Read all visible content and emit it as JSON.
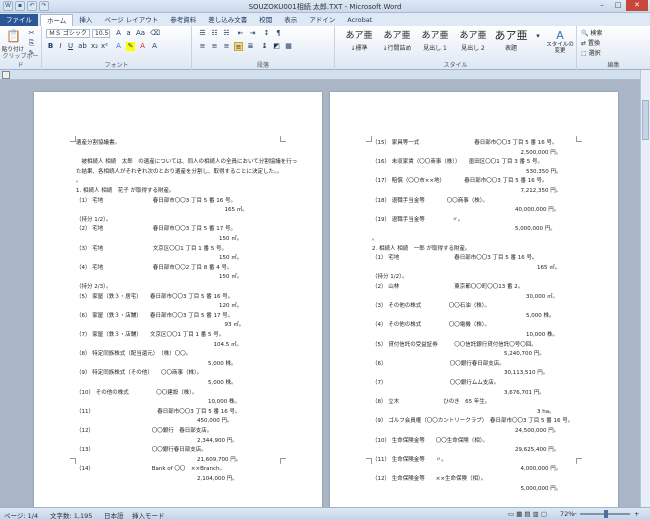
{
  "window": {
    "title": "SOUZOKU001相続 太郎.TXT - Microsoft Word"
  },
  "tabs": [
    "ファイル",
    "ホーム",
    "挿入",
    "ページ レイアウト",
    "参考資料",
    "差し込み文書",
    "校閲",
    "表示",
    "アドイン",
    "Acrobat"
  ],
  "ribbon": {
    "clipboard": {
      "paste": "貼り付け",
      "label": "クリップボード"
    },
    "font": {
      "name": "ＭＳ ゴシック",
      "size": "10.5",
      "label": "フォント"
    },
    "paragraph": {
      "label": "段落"
    },
    "styles": {
      "label": "スタイル",
      "items": [
        {
          "preview": "あア亜",
          "name": "↓標準"
        },
        {
          "preview": "あア亜",
          "name": "↓行間詰め"
        },
        {
          "preview": "あア亜",
          "name": "見出し 1"
        },
        {
          "preview": "あア亜",
          "name": "見出し 2"
        },
        {
          "preview": "あア亜",
          "name": "表題"
        }
      ],
      "change": "スタイルの変更"
    },
    "edit": {
      "label": "編集",
      "find": "検索",
      "replace": "置換",
      "select": "選択"
    }
  },
  "statusbar": {
    "page": "ページ: 1/4",
    "words": "文字数: 1,195",
    "lang": "日本語",
    "mode": "挿入モード",
    "zoom": "72%"
  },
  "page1": [
    "遺産分割協議書。",
    "",
    "　被相続人 相続　太郎　の遺産については、同人の相続人の全員において分割協議を行っ",
    "た結果、各相続人がそれぞれ次のとおり遺産を分割し、取得することに決定した。。",
    "。",
    "1. 相続人 相続　花子 が取得する財産。",
    "（1） 宅地　　　　　　　　　春日部市〇〇3 丁目 5 番 16 号。",
    "　　　　　　　　　　　　　　　　　　　　　　　　　　　165 ㎡。",
    "（持分 1/2）。",
    "（2） 宅地　　　　　　　　　春日部市〇〇3 丁目 5 番 17 号。",
    "　　　　　　　　　　　　　　　　　　　　　　　　　　150 ㎡。",
    "（3） 宅地　　　　　　　　　文京区〇〇1 丁目 1 番 5 号。",
    "　　　　　　　　　　　　　　　　　　　　　　　　　　150 ㎡。",
    "（4） 宅地　　　　　　　　　春日部市〇〇2 丁目 8 番 4 号。",
    "　　　　　　　　　　　　　　　　　　　　　　　　　　150 ㎡。",
    "（持分 2/3）。",
    "（5） 家屋（鉄３・居宅）　　春日部市〇〇3 丁目 5 番 16 号。",
    "　　　　　　　　　　　　　　　　　　　　　　　　　　120 ㎡。",
    "（6） 家屋（鉄３・店舗）　　春日部市〇〇3 丁目 5 番 17 号。",
    "　　　　　　　　　　　　　　　　　　　　　　　　　　　93 ㎡。",
    "（7） 家屋（鉄３・店舗）　　文京区〇〇1 丁目 1 番 5 号。",
    "　　　　　　　　　　　　　　　　　　　　　　　　　104.5 ㎡。",
    "（8） 特定同族株式（配当還元）　（株）〇〇。",
    "　　　　　　　　　　　　　　　　　　　　　　　　5,000 株。",
    "（9） 特定同族株式（その他）　　〇〇商事（株）。",
    "　　　　　　　　　　　　　　　　　　　　　　　　5,000 株。",
    "（10） その他の株式　　　　　〇〇建設（株）。",
    "　　　　　　　　　　　　　　　　　　　　　　　　10,000 株。",
    "（11）　　　　　　　　　　　　春日部市〇〇3 丁目 5 番 16 号。",
    "　　　　　　　　　　　　　　　　　　　　　　450,000 円。",
    "（12）　　　　　　　　　　　〇〇銀行　春日部支店。",
    "　　　　　　　　　　　　　　　　　　　　　　2,344,900 円。",
    "（13）　　　　　　　　　　　〇〇銀行春日部支店。",
    "　　　　　　　　　　　　　　　　　　　　　　21,609,700 円。",
    "（14）　　　　　　　　　　　Bank of 〇〇　××Branch。",
    "　　　　　　　　　　　　　　　　　　　　　　2,104,000 円。"
  ],
  "page2": [
    "（15） 家具等一式　　　　　　　　　　春日部市〇〇3 丁目 5 番 16 号。",
    "　　　　　　　　　　　　　　　　　　　　　　　　　　　2,500,000 円。",
    "（16） 未収家賃（〇〇商事（株））　　墨田区〇〇1 丁目 3 番 5 号。",
    "　　　　　　　　　　　　　　　　　　　　　　　　　　　　530,350 円。",
    "（17） 賠償（〇〇市××地）　　　　春日部市〇〇3 丁目 5 番 16 号。",
    "　　　　　　　　　　　　　　　　　　　　　　　　　　　7,212,350 円。",
    "（18） 退職手当金等　　　　〇〇商事（株）。",
    "　　　　　　　　　　　　　　　　　　　　　　　　　　40,000,000 円。",
    "（19） 退職手当金等　　　　　〃。",
    "　　　　　　　　　　　　　　　　　　　　　　　　　　5,000,000 円。",
    "。",
    "2. 相続人 相続　一郎 が取得する財産。",
    "（1） 宅地　　　　　　　　　　春日部市〇〇3 丁目 5 番 16 号。",
    "　　　　　　　　　　　　　　　　　　　　　　　　　　　　　　165 ㎡。",
    "（持分 1/2）。",
    "（2） 山林　　　　　　　　　　東京都〇〇町〇〇13 番 2。",
    "　　　　　　　　　　　　　　　　　　　　　　　　　　　　30,000 ㎡。",
    "（3） その他の株式　　　　　〇〇石油（株）。",
    "　　　　　　　　　　　　　　　　　　　　　　　　　　　　5,000 株。",
    "（4） その他の株式　　　　　〇〇電機（株）。",
    "　　　　　　　　　　　　　　　　　　　　　　　　　　　　10,000 株。",
    "（5） 貸付信託の受益証券　　　〇〇信託銀行貸付信託〇号〇回。",
    "　　　　　　　　　　　　　　　　　　　　　　　　5,240,700 円。",
    "（6）　　　　　　　　　　　　〇〇銀行春日部支店。",
    "　　　　　　　　　　　　　　　　　　　　　　　　30,113,510 円。",
    "（7）　　　　　　　　　　　　〇〇銀行ムム支店。",
    "　　　　　　　　　　　　　　　　　　　　　　　　3,676,701 円。",
    "（8） 立木　　　　　　　　ひのき　65 年生。",
    "　　　　　　　　　　　　　　　　　　　　　　　　　　　　　　3 ha。",
    "（9） ゴルフ会員権（〇〇カントリークラブ）　春日部市〇〇3 丁目 5 番 16 号。",
    "　　　　　　　　　　　　　　　　　　　　　　　　　　24,500,000 円。",
    "（10） 生命保険金等　　〇〇生命保険（相）。",
    "　　　　　　　　　　　　　　　　　　　　　　　　　　29,625,400 円。",
    "（11） 生命保険金等　　〃。",
    "　　　　　　　　　　　　　　　　　　　　　　　　　　　4,000,000 円。",
    "（12） 生命保険金等　　××生命保険（相）。",
    "　　　　　　　　　　　　　　　　　　　　　　　　　　　5,000,000 円。"
  ]
}
